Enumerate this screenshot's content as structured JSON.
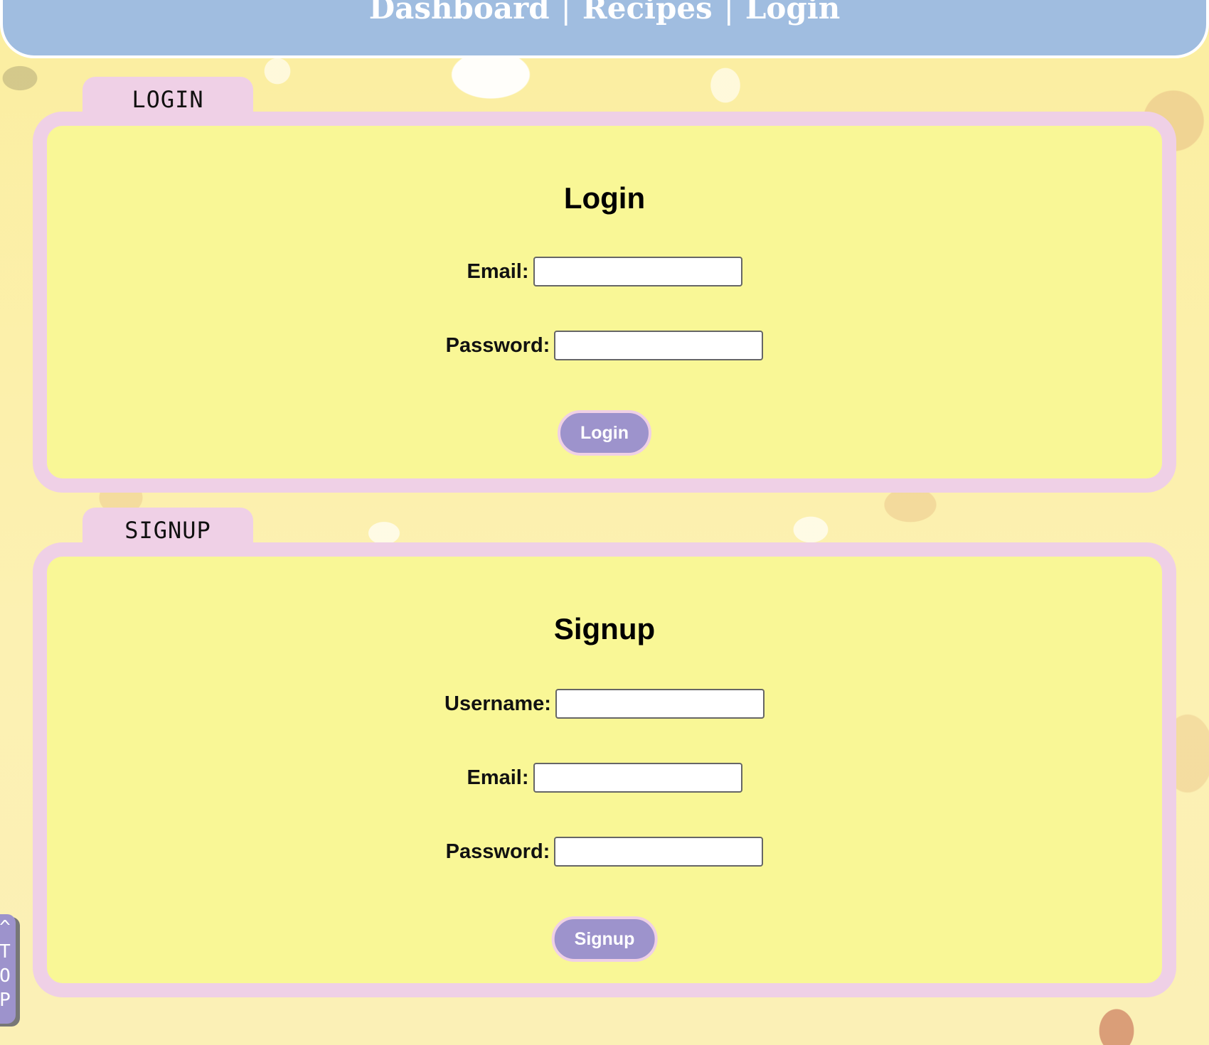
{
  "nav": {
    "items": [
      "Dashboard",
      "Recipes",
      "Login"
    ],
    "separator": "|"
  },
  "login": {
    "tab_label": "LOGIN",
    "title": "Login",
    "fields": [
      {
        "label": "Email:",
        "value": ""
      },
      {
        "label": "Password:",
        "value": ""
      }
    ],
    "button_label": "Login"
  },
  "signup": {
    "tab_label": "SIGNUP",
    "title": "Signup",
    "fields": [
      {
        "label": "Username:",
        "value": ""
      },
      {
        "label": "Email:",
        "value": ""
      },
      {
        "label": "Password:",
        "value": ""
      }
    ],
    "button_label": "Signup"
  },
  "back_to_top": {
    "chars": [
      "^",
      "T",
      "O",
      "P"
    ]
  },
  "colors": {
    "header": "#a0bde0",
    "card": "#f9f796",
    "card_border": "#efd0e6",
    "button": "#9d93cc"
  }
}
